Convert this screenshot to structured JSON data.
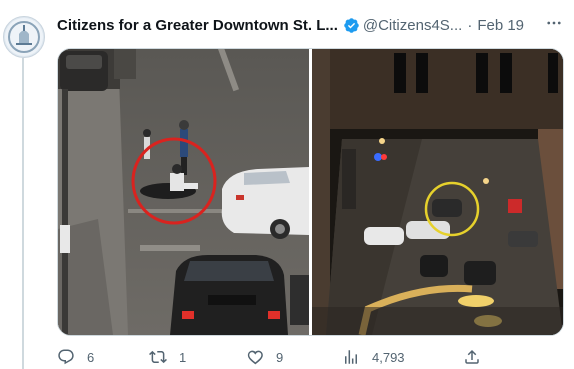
{
  "author": {
    "name": "Citizens for a Greater Downtown St. L...",
    "handle": "@Citizens4S...",
    "separator": "·",
    "date": "Feb 19"
  },
  "more_icon": "more-options-icon",
  "media": {
    "photos": [
      "photo-left",
      "photo-right"
    ]
  },
  "actions": {
    "reply": {
      "icon": "reply-icon",
      "count": "6"
    },
    "retweet": {
      "icon": "retweet-icon",
      "count": "1"
    },
    "like": {
      "icon": "heart-icon",
      "count": "9"
    },
    "views": {
      "icon": "views-chart-icon",
      "count": "4,793"
    },
    "share": {
      "icon": "share-icon"
    }
  },
  "colors": {
    "text_primary": "#0f1419",
    "text_secondary": "#536471",
    "verified_badge": "#1d9bf0",
    "border": "#cfd9de"
  }
}
